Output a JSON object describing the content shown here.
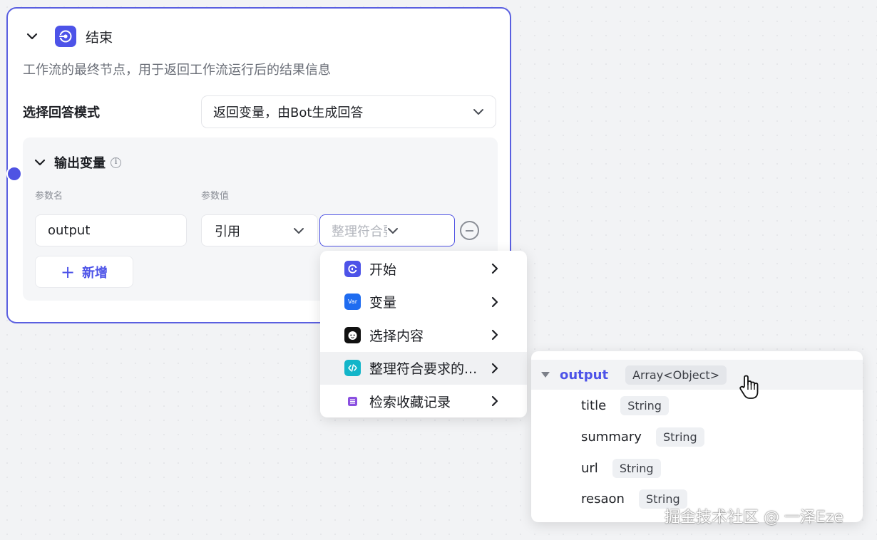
{
  "node": {
    "title": "结束",
    "description": "工作流的最终节点，用于返回工作流运行后的结果信息",
    "mode_label": "选择回答模式",
    "mode_value": "返回变量，由Bot生成回答",
    "accent_color": "#4d53e8"
  },
  "output_panel": {
    "title": "输出变量",
    "col_name_label": "参数名",
    "col_value_label": "参数值",
    "param_name": "output",
    "ref_type": "引用",
    "value_placeholder": "整理符合要求的",
    "add_label": "新增",
    "add_icon": "plus-icon"
  },
  "menu": {
    "items": [
      {
        "label": "开始",
        "icon": "start-icon",
        "color": "#4d53e8"
      },
      {
        "label": "变量",
        "icon": "var-icon",
        "color": "#1f6cf0"
      },
      {
        "label": "选择内容",
        "icon": "face-icon",
        "color": "#111111"
      },
      {
        "label": "整理符合要求的...",
        "icon": "code-icon",
        "color": "#12b5c9"
      },
      {
        "label": "检索收藏记录",
        "icon": "list-icon",
        "color": "#8a4fe0"
      }
    ],
    "var_icon_text": "Var"
  },
  "submenu": {
    "root": {
      "name": "output",
      "type": "Array<Object>"
    },
    "fields": [
      {
        "name": "title",
        "type": "String"
      },
      {
        "name": "summary",
        "type": "String"
      },
      {
        "name": "url",
        "type": "String"
      },
      {
        "name": "resaon",
        "type": "String"
      }
    ]
  },
  "watermark": "掘金技术社区 @ 一泽Eze"
}
